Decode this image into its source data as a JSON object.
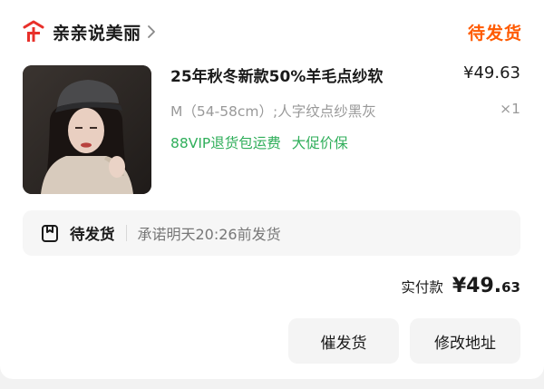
{
  "shop": {
    "name": "亲亲说美丽",
    "logo_icon": "tmall-logo-icon",
    "accent": "#e8302a"
  },
  "order": {
    "status": "待发货",
    "status_color": "#ff5a00"
  },
  "product": {
    "title": "25年秋冬新款50%羊毛点纱软",
    "price": "¥49.63",
    "spec": "M（54-58cm）;人字纹点纱黑灰",
    "quantity": "×1",
    "tags": [
      "88VIP退货包运费",
      "大促价保"
    ],
    "tag_color": "#2fae5a"
  },
  "shipping": {
    "status": "待发货",
    "promise": "承诺明天20:26前发货",
    "icon": "package-box-icon"
  },
  "payment": {
    "label": "实付款",
    "amount_int": "¥49.",
    "amount_dec": "63"
  },
  "actions": {
    "urge_label": "催发货",
    "change_address_label": "修改地址"
  }
}
